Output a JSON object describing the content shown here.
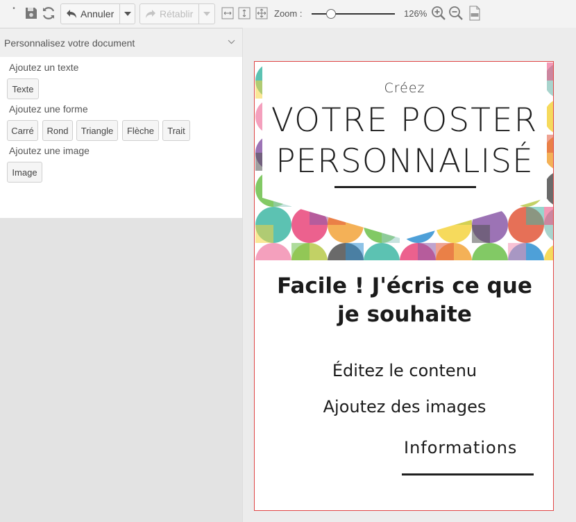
{
  "toolbar": {
    "undo_label": "Annuler",
    "redo_label": "Rétablir",
    "zoom_label": "Zoom :",
    "zoom_value": "126%",
    "zoom_fraction": 0.2
  },
  "panel": {
    "title": "Personnalisez votre document",
    "text_section": "Ajoutez un texte",
    "text_button": "Texte",
    "shape_section": "Ajoutez une forme",
    "shapes": [
      "Carré",
      "Rond",
      "Triangle",
      "Flèche",
      "Trait"
    ],
    "image_section": "Ajoutez une image",
    "image_button": "Image"
  },
  "poster": {
    "brand": "Créez",
    "title_line1": "VOTRE POSTER",
    "title_line2": "PERSONNALISÉ",
    "headline_line1": "Facile ! J'écris ce que",
    "headline_line2": "je souhaite",
    "line1": "Éditez le contenu",
    "line2": "Ajoutez des images",
    "info": "Informations"
  },
  "colors": {
    "pattern": [
      "#3fb7a4",
      "#e9457a",
      "#f2a33a",
      "#6cc04a",
      "#2f8fd1",
      "#f5d33f",
      "#8b5aa8",
      "#e2573a",
      "#99ccc4",
      "#f28fb2",
      "#b7c94a",
      "#505050"
    ]
  }
}
